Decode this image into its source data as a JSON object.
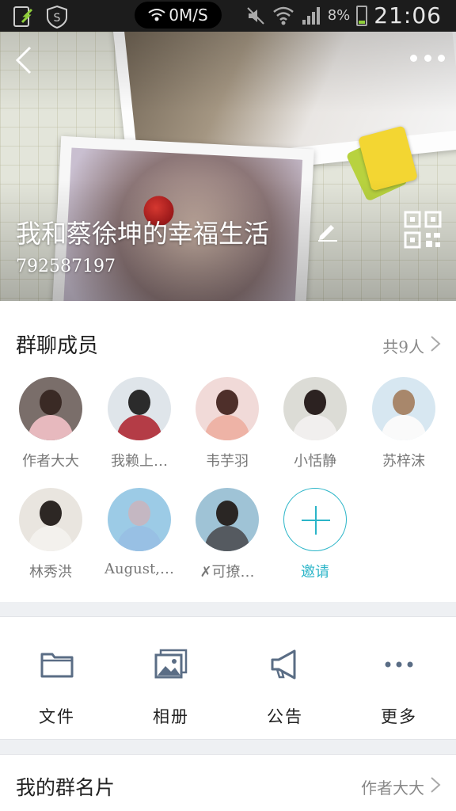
{
  "status_bar": {
    "network_speed": "0M/S",
    "battery": "8%",
    "time": "21:06",
    "icons": [
      "sim-update-icon",
      "shield-s-icon",
      "wifi-icon",
      "mute-icon",
      "wifi-signal-icon",
      "cell-signal-icon",
      "battery-icon"
    ]
  },
  "header": {
    "group_name": "我和蔡徐坤的幸福生活",
    "group_id": "792587197",
    "icons": [
      "back-icon",
      "more-icon",
      "edit-pencil-icon",
      "qr-code-icon"
    ]
  },
  "members": {
    "title": "群聊成员",
    "count": "共9人",
    "list": [
      {
        "name": "作者大大",
        "color_head": "#3a2a25",
        "color_body": "#e7b9be",
        "bg": "#7a6e6a"
      },
      {
        "name": "我赖上…",
        "color_head": "#2b2b2b",
        "color_body": "#b43c46",
        "bg": "#dfe5ea"
      },
      {
        "name": "韦芋羽",
        "color_head": "#4e2f2a",
        "color_body": "#eeb3a6",
        "bg": "#f1dad8"
      },
      {
        "name": "小恬静",
        "color_head": "#2c2221",
        "color_body": "#f1efee",
        "bg": "#dcdcd6"
      },
      {
        "name": "苏梓沫",
        "color_head": "#a8876b",
        "color_body": "#fafafa",
        "bg": "#d7e7f1"
      },
      {
        "name": "林秀洪",
        "color_head": "#2d2724",
        "color_body": "#f3f1ed",
        "bg": "#e9e5df"
      },
      {
        "name": "August,…",
        "color_head": "#c4b7c2",
        "color_body": "#98c0e4",
        "bg": "#9ccbe6"
      },
      {
        "name": "✗可撩…",
        "color_head": "#2a2624",
        "color_body": "#555a60",
        "bg": "#9fc3d6"
      }
    ],
    "invite_label": "邀请"
  },
  "actions": [
    {
      "label": "文件",
      "icon": "folder-icon"
    },
    {
      "label": "相册",
      "icon": "photo-album-icon"
    },
    {
      "label": "公告",
      "icon": "megaphone-icon"
    },
    {
      "label": "更多",
      "icon": "more-dots-icon"
    }
  ],
  "card": {
    "title": "我的群名片",
    "value": "作者大大"
  },
  "colors": {
    "accent": "#2bb5c8",
    "icon": "#5a6d85",
    "text_secondary": "#888888"
  }
}
